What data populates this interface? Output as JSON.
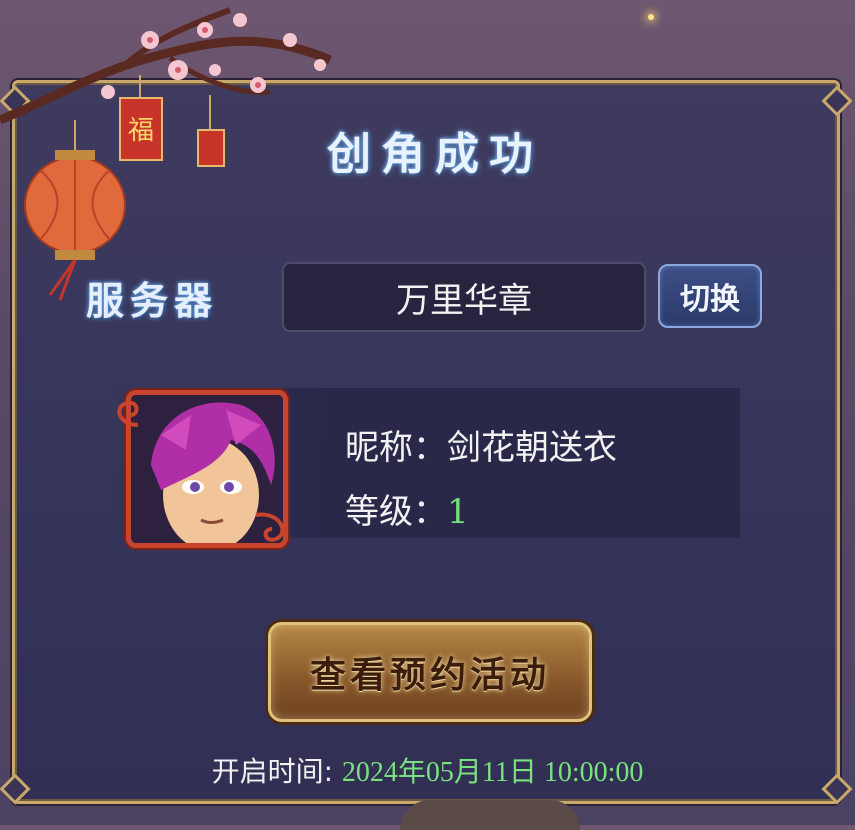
{
  "dialog": {
    "title": "创角成功",
    "server_label": "服务器",
    "server_name": "万里华章",
    "switch_label": "切换"
  },
  "character": {
    "nickname_label": "昵称：",
    "nickname": "剑花朝送衣",
    "level_label": "等级：",
    "level": "1"
  },
  "action": {
    "button_label": "查看预约活动"
  },
  "open_time": {
    "label": "开启时间: ",
    "value": "2024年05月11日 10:00:00"
  },
  "decorations": {
    "lantern_char": "福",
    "colors": {
      "frame_gold": "#c9a86a",
      "panel_bg": "#3a3657",
      "level_green": "#74e07a",
      "avatar_frame_red": "#c9442f"
    }
  }
}
